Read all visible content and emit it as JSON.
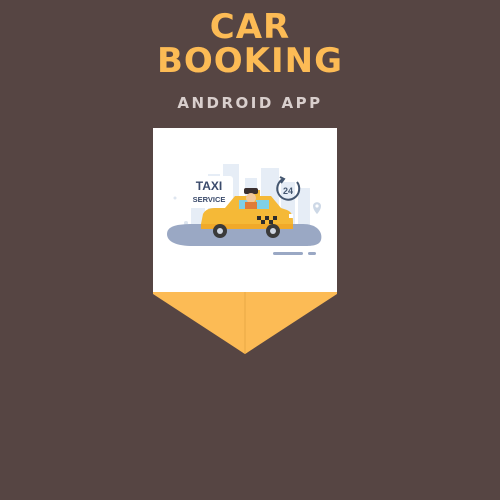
{
  "header": {
    "title_line1": "CAR",
    "title_line2": "BOOKING",
    "subtitle": "ANDROID APP"
  },
  "illustration": {
    "sign_line1": "TAXI",
    "sign_line2": "SERVICE",
    "badge": "24",
    "icons": [
      "taxi-car-icon",
      "driver-icon",
      "clock-24-icon",
      "location-pin-icon"
    ]
  },
  "colors": {
    "background": "#564543",
    "accent": "#fcbb55",
    "subtitle": "#d9cfcd",
    "card": "#ffffff",
    "taxi": "#f5b937"
  }
}
